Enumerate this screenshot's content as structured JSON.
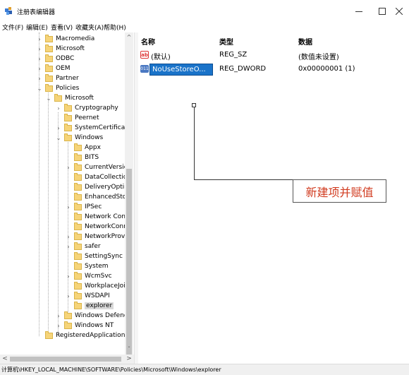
{
  "window": {
    "title": "注册表编辑器",
    "icon": "registry-editor-icon",
    "controls": [
      "minimize",
      "maximize",
      "close"
    ]
  },
  "menu": [
    "文件(F)",
    "编辑(E)",
    "查看(V)",
    "收藏夹(A)",
    "帮助(H)"
  ],
  "tree": {
    "items": [
      {
        "label": "Macromedia",
        "expander": "›"
      },
      {
        "label": "Microsoft",
        "expander": "›"
      },
      {
        "label": "ODBC",
        "expander": "›"
      },
      {
        "label": "OEM",
        "expander": "›"
      },
      {
        "label": "Partner",
        "expander": "›"
      },
      {
        "label": "Policies",
        "expander": "⌄"
      },
      {
        "label": "Microsoft",
        "expander": "⌄"
      },
      {
        "label": "Cryptography",
        "expander": "›"
      },
      {
        "label": "Peernet",
        "expander": ""
      },
      {
        "label": "SystemCertificate",
        "expander": "›"
      },
      {
        "label": "Windows",
        "expander": "⌄"
      },
      {
        "label": "Appx",
        "expander": ""
      },
      {
        "label": "BITS",
        "expander": ""
      },
      {
        "label": "CurrentVersic",
        "expander": "›"
      },
      {
        "label": "DataCollectio",
        "expander": ""
      },
      {
        "label": "DeliveryOptin",
        "expander": ""
      },
      {
        "label": "EnhancedStor",
        "expander": ""
      },
      {
        "label": "IPSec",
        "expander": "›"
      },
      {
        "label": "Network Con",
        "expander": ""
      },
      {
        "label": "NetworkConr",
        "expander": ""
      },
      {
        "label": "NetworkProvi",
        "expander": "›"
      },
      {
        "label": "safer",
        "expander": "›"
      },
      {
        "label": "SettingSync",
        "expander": ""
      },
      {
        "label": "System",
        "expander": ""
      },
      {
        "label": "WcmSvc",
        "expander": "›"
      },
      {
        "label": "WorkplaceJoi",
        "expander": ""
      },
      {
        "label": "WSDAPI",
        "expander": "›"
      },
      {
        "label": "explorer",
        "expander": "",
        "selected": true
      },
      {
        "label": "Windows Defend",
        "expander": "›"
      },
      {
        "label": "Windows NT",
        "expander": "›"
      },
      {
        "label": "RegisteredApplications",
        "expander": ""
      }
    ]
  },
  "list": {
    "columns": [
      "名称",
      "类型",
      "数据"
    ],
    "rows": [
      {
        "icon": "string-value-icon",
        "icon_glyph": "ab",
        "name": "(默认)",
        "type": "REG_SZ",
        "data": "(数值未设置)"
      },
      {
        "icon": "binary-value-icon",
        "icon_glyph": "011",
        "name": "NoUseStoreO...",
        "type": "REG_DWORD",
        "data": "0x00000001 (1)",
        "editing": true
      }
    ]
  },
  "annotation": {
    "text": "新建项并赋值"
  },
  "statusbar": {
    "path": "计算机\\HKEY_LOCAL_MACHINE\\SOFTWARE\\Policies\\Microsoft\\Windows\\explorer"
  },
  "scroll_glyphs": {
    "up": "^",
    "down": "ˇ",
    "left": "<",
    "right": ">"
  },
  "colors": {
    "selection_blue": "#1a73c9",
    "annotation_red": "#d13b1f",
    "folder_yellow": "#f6d479"
  }
}
